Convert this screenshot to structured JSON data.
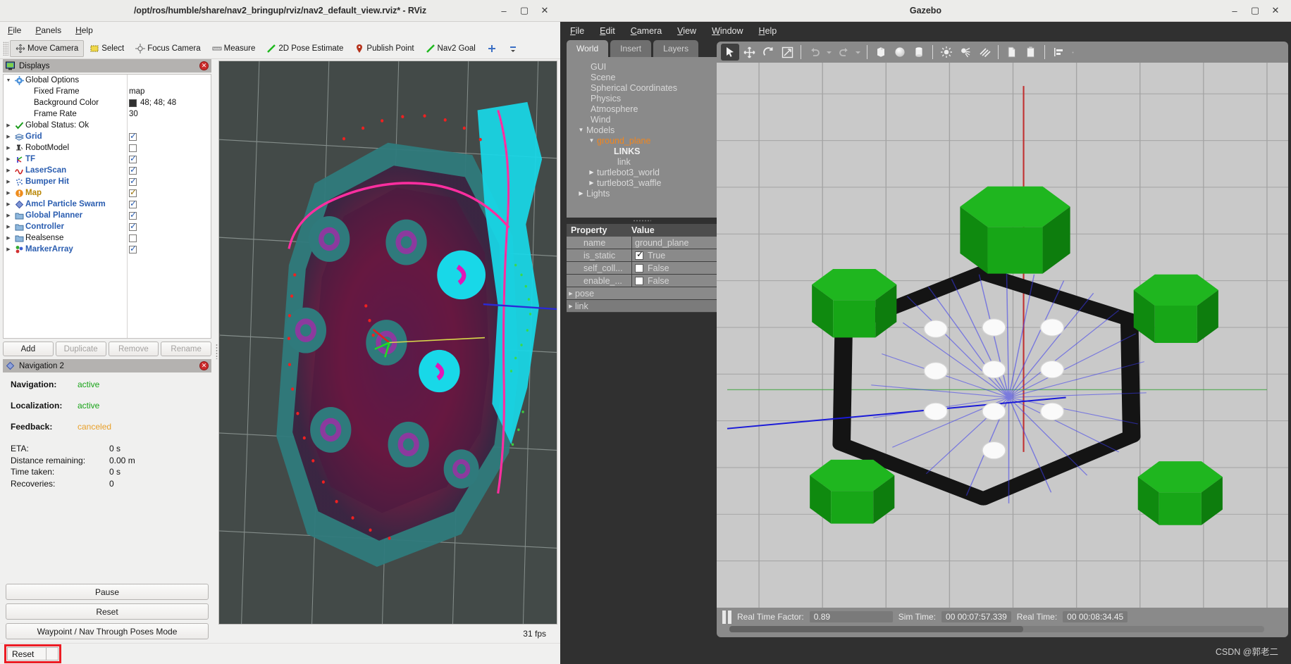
{
  "rviz": {
    "title": "/opt/ros/humble/share/nav2_bringup/rviz/nav2_default_view.rviz* - RViz",
    "window_buttons": {
      "minimize": "–",
      "maximize": "▢",
      "close": "✕"
    },
    "menus": [
      "File",
      "Panels",
      "Help"
    ],
    "toolbar": [
      {
        "label": "Move Camera",
        "icon": "move-camera-icon",
        "active": true
      },
      {
        "label": "Select",
        "icon": "select-icon",
        "active": false
      },
      {
        "label": "Focus Camera",
        "icon": "focus-camera-icon",
        "active": false
      },
      {
        "label": "Measure",
        "icon": "measure-icon",
        "active": false
      },
      {
        "label": "2D Pose Estimate",
        "icon": "pose-estimate-icon",
        "active": false
      },
      {
        "label": "Publish Point",
        "icon": "publish-point-icon",
        "active": false
      },
      {
        "label": "Nav2 Goal",
        "icon": "nav2-goal-icon",
        "active": false
      }
    ],
    "displays_panel": {
      "title": "Displays",
      "icon": "displays-icon",
      "rows": [
        {
          "label": "Global Options",
          "icon": "gear-icon",
          "arrow": "down",
          "style": "plain",
          "value_type": "none"
        },
        {
          "label": "Fixed Frame",
          "icon": "none",
          "arrow": "none",
          "style": "plain",
          "value_type": "text",
          "value": "map",
          "indent": 2
        },
        {
          "label": "Background Color",
          "icon": "none",
          "arrow": "none",
          "style": "plain",
          "value_type": "color",
          "value": "48; 48; 48",
          "color": "#303030",
          "indent": 2
        },
        {
          "label": "Frame Rate",
          "icon": "none",
          "arrow": "none",
          "style": "plain",
          "value_type": "text",
          "value": "30",
          "indent": 2
        },
        {
          "label": "Global Status: Ok",
          "icon": "check-icon",
          "arrow": "right",
          "style": "plain",
          "value_type": "none"
        },
        {
          "label": "Grid",
          "icon": "grid-icon",
          "arrow": "right",
          "style": "blue",
          "value_type": "checkbox",
          "checked": true
        },
        {
          "label": "RobotModel",
          "icon": "robot-icon",
          "arrow": "right",
          "style": "plain",
          "value_type": "checkbox",
          "checked": false
        },
        {
          "label": "TF",
          "icon": "tf-icon",
          "arrow": "right",
          "style": "blue",
          "value_type": "checkbox",
          "checked": true
        },
        {
          "label": "LaserScan",
          "icon": "laserscan-icon",
          "arrow": "right",
          "style": "blue",
          "value_type": "checkbox",
          "checked": true
        },
        {
          "label": "Bumper Hit",
          "icon": "bumper-icon",
          "arrow": "right",
          "style": "blue",
          "value_type": "checkbox",
          "checked": true
        },
        {
          "label": "Map",
          "icon": "map-warning-icon",
          "arrow": "right",
          "style": "orange",
          "value_type": "checkbox",
          "checked": true,
          "check_color": "amber"
        },
        {
          "label": "Amcl Particle Swarm",
          "icon": "particle-icon",
          "arrow": "right",
          "style": "blue",
          "value_type": "checkbox",
          "checked": true
        },
        {
          "label": "Global Planner",
          "icon": "folder-icon",
          "arrow": "right",
          "style": "blue",
          "value_type": "checkbox",
          "checked": true
        },
        {
          "label": "Controller",
          "icon": "folder-icon",
          "arrow": "right",
          "style": "blue",
          "value_type": "checkbox",
          "checked": true
        },
        {
          "label": "Realsense",
          "icon": "folder-icon",
          "arrow": "right",
          "style": "plain",
          "value_type": "checkbox",
          "checked": false
        },
        {
          "label": "MarkerArray",
          "icon": "markerarray-icon",
          "arrow": "right",
          "style": "blue",
          "value_type": "checkbox",
          "checked": true
        }
      ],
      "buttons": [
        {
          "label": "Add",
          "enabled": true
        },
        {
          "label": "Duplicate",
          "enabled": false
        },
        {
          "label": "Remove",
          "enabled": false
        },
        {
          "label": "Rename",
          "enabled": false
        }
      ]
    },
    "nav2_panel": {
      "title": "Navigation 2",
      "icon": "nav2-icon",
      "status": [
        {
          "key": "Navigation:",
          "value": "active",
          "color": "green"
        },
        {
          "key": "Localization:",
          "value": "active",
          "color": "green"
        },
        {
          "key": "Feedback:",
          "value": "canceled",
          "color": "orange"
        }
      ],
      "stats": [
        {
          "key": "ETA:",
          "value": "0 s"
        },
        {
          "key": "Distance remaining:",
          "value": "0.00 m"
        },
        {
          "key": "Time taken:",
          "value": "0 s"
        },
        {
          "key": "Recoveries:",
          "value": "0"
        }
      ],
      "buttons": [
        "Pause",
        "Reset",
        "Waypoint / Nav Through Poses Mode"
      ]
    },
    "status_bar": {
      "fps": "31 fps"
    },
    "bottom_bar": {
      "reset_label": "Reset",
      "highlight_color": "#ec1c24"
    }
  },
  "gazebo": {
    "title": "Gazebo",
    "window_buttons": {
      "minimize": "–",
      "maximize": "▢",
      "close": "✕"
    },
    "menus": [
      "File",
      "Edit",
      "Camera",
      "View",
      "Window",
      "Help"
    ],
    "tabs": [
      {
        "label": "World",
        "active": true
      },
      {
        "label": "Insert",
        "active": false
      },
      {
        "label": "Layers",
        "active": false
      }
    ],
    "tree": [
      {
        "label": "GUI",
        "arrow": "none",
        "indent": 1,
        "style": "plain"
      },
      {
        "label": "Scene",
        "arrow": "none",
        "indent": 1,
        "style": "plain"
      },
      {
        "label": "Spherical Coordinates",
        "arrow": "none",
        "indent": 1,
        "style": "plain"
      },
      {
        "label": "Physics",
        "arrow": "none",
        "indent": 1,
        "style": "plain"
      },
      {
        "label": "Atmosphere",
        "arrow": "none",
        "indent": 1,
        "style": "plain"
      },
      {
        "label": "Wind",
        "arrow": "none",
        "indent": 1,
        "style": "plain"
      },
      {
        "label": "Models",
        "arrow": "down",
        "indent": 0,
        "style": "plain"
      },
      {
        "label": "ground_plane",
        "arrow": "down",
        "indent": 1,
        "style": "orange"
      },
      {
        "label": "LINKS",
        "arrow": "none",
        "indent": 3,
        "style": "bold"
      },
      {
        "label": "link",
        "arrow": "none",
        "indent": 3,
        "style": "plain"
      },
      {
        "label": "turtlebot3_world",
        "arrow": "right",
        "indent": 1,
        "style": "plain"
      },
      {
        "label": "turtlebot3_waffle",
        "arrow": "right",
        "indent": 1,
        "style": "plain"
      },
      {
        "label": "Lights",
        "arrow": "right",
        "indent": 0,
        "style": "plain"
      }
    ],
    "property_table": {
      "headers": [
        "Property",
        "Value"
      ],
      "rows": [
        {
          "property": "name",
          "type": "text",
          "value": "ground_plane"
        },
        {
          "property": "is_static",
          "type": "checkbox",
          "checked": true,
          "value": "True"
        },
        {
          "property": "self_coll...",
          "type": "checkbox",
          "checked": false,
          "value": "False"
        },
        {
          "property": "enable_...",
          "type": "checkbox",
          "checked": false,
          "value": "False"
        },
        {
          "property": "pose",
          "type": "expandable",
          "value": ""
        },
        {
          "property": "link",
          "type": "expandable",
          "value": "",
          "selected": true
        }
      ]
    },
    "toolbar_icons": [
      "select-arrow-icon",
      "translate-icon",
      "rotate-icon",
      "scale-icon",
      "undo-icon",
      "undo-dropdown-icon",
      "redo-icon",
      "redo-dropdown-icon",
      "box-icon",
      "sphere-icon",
      "cylinder-icon",
      "point-light-icon",
      "spot-light-icon",
      "directional-light-icon",
      "copy-icon",
      "paste-icon",
      "align-icon",
      "snap-icon"
    ],
    "status": {
      "pause_icon": "pause-icon",
      "real_time_factor_label": "Real Time Factor:",
      "real_time_factor_value": "0.89",
      "sim_time_label": "Sim Time:",
      "sim_time_value": "00 00:07:57.339",
      "real_time_label": "Real Time:",
      "real_time_value": "00 00:08:34.45"
    },
    "watermark": "CSDN @郭老二"
  }
}
